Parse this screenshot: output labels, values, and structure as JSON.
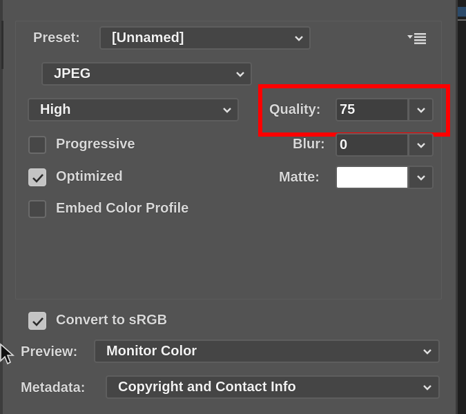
{
  "preset": {
    "label": "Preset:",
    "value": "[Unnamed]",
    "menu_icon": "panel-menu-icon"
  },
  "format": {
    "value": "JPEG"
  },
  "compression_quality": {
    "value": "High"
  },
  "quality": {
    "label": "Quality:",
    "value": "75",
    "highlight_color": "#ff0000"
  },
  "blur": {
    "label": "Blur:",
    "value": "0"
  },
  "matte": {
    "label": "Matte:",
    "color": "#ffffff"
  },
  "options": [
    {
      "label": "Progressive",
      "checked": false
    },
    {
      "label": "Optimized",
      "checked": true
    },
    {
      "label": "Embed Color Profile",
      "checked": false
    }
  ],
  "convert_srgb": {
    "label": "Convert to sRGB",
    "checked": true
  },
  "preview": {
    "label": "Preview:",
    "value": "Monitor Color"
  },
  "metadata": {
    "label": "Metadata:",
    "value": "Copyright and Contact Info"
  },
  "colors": {
    "panel_bg": "#535353",
    "field_bg": "#454545",
    "text": "#e8e8e8",
    "checkbox_checked": "#c4c4c4"
  }
}
